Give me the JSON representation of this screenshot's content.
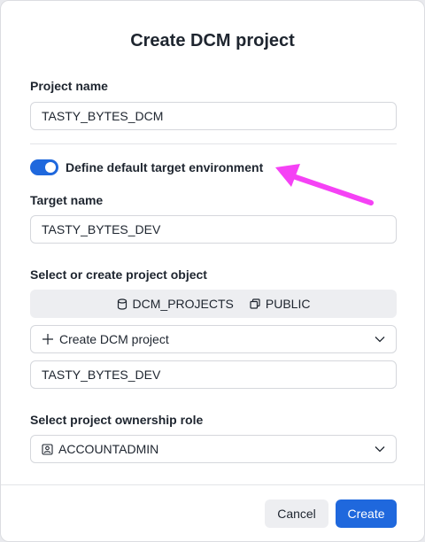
{
  "dialog": {
    "title": "Create DCM project"
  },
  "project_name": {
    "label": "Project name",
    "value": "TASTY_BYTES_DCM"
  },
  "toggle": {
    "label": "Define default target environment",
    "checked": true,
    "color": "#1f68dd"
  },
  "target_name": {
    "label": "Target name",
    "value": "TASTY_BYTES_DEV"
  },
  "project_object": {
    "label": "Select or create project object",
    "database": "DCM_PROJECTS",
    "database_icon": "database-icon",
    "schema": "PUBLIC",
    "schema_icon": "schema-icon",
    "select_value": "Create DCM project",
    "select_icon": "plus-icon",
    "name_value": "TASTY_BYTES_DEV"
  },
  "ownership": {
    "label": "Select project ownership role",
    "value": "ACCOUNTADMIN",
    "icon": "role-icon"
  },
  "footer": {
    "cancel_label": "Cancel",
    "create_label": "Create"
  },
  "annotation": {
    "arrow_color": "#f542f5",
    "icon": "arrow-annotation"
  }
}
